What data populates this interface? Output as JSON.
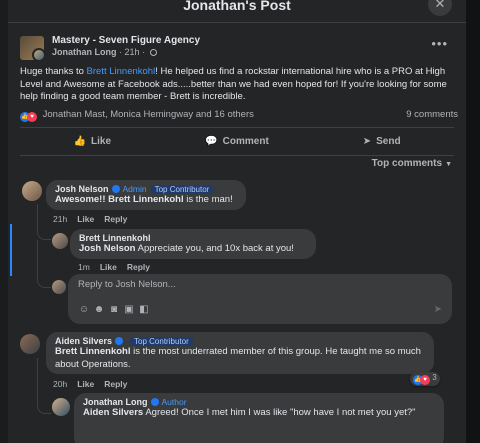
{
  "modal": {
    "title": "Jonathan's Post",
    "close_label": "✕"
  },
  "post": {
    "group": "Mastery - Seven Figure Agency",
    "author": "Jonathan Long",
    "time": "21h",
    "separator": "·",
    "more": "•••",
    "body": {
      "intro": "Huge thanks to ",
      "mention": "Brett Linnenkohl",
      "rest": "! He helped us find a rockstar international hire who is a PRO at High Level and Awesome at Facebook ads.....better than we had even hoped for! If you're looking for some help finding a good team member - Brett is incredible."
    },
    "reactors": "Jonathan Mast, Monica Hemingway and 16 others",
    "comment_count": "9 comments"
  },
  "actions": {
    "like": "Like",
    "comment": "Comment",
    "send": "Send"
  },
  "sort": {
    "label": "Top comments"
  },
  "comments": {
    "c1": {
      "name": "Josh Nelson",
      "role": "Admin",
      "tag": "Top Contributor",
      "text_mention": "Awesome!! Brett Linnenkohl",
      "text_rest": " is the man!",
      "time": "21h",
      "like": "Like",
      "reply": "Reply"
    },
    "r1": {
      "name": "Brett Linnenkohl",
      "text_mention": "Josh Nelson",
      "text_rest": " Appreciate you, and 10x back at you!",
      "time": "1m",
      "like": "Like",
      "reply": "Reply"
    },
    "reply_box": {
      "placeholder": "Reply to Josh Nelson..."
    },
    "c2": {
      "name": "Aiden Silvers",
      "tag": "Top Contributor",
      "text_mention": "Brett Linnenkohl",
      "text_rest": " is the most underrated member of this group. He taught me so much about Operations.",
      "time": "20h",
      "like": "Like",
      "reply": "Reply",
      "reaction_count": "3"
    },
    "r2": {
      "name": "Jonathan Long",
      "role": "Author",
      "text_mention": "Aiden Silvers",
      "text_rest": " Agreed! Once I met him I was like \"how have I not met you yet?\""
    }
  }
}
